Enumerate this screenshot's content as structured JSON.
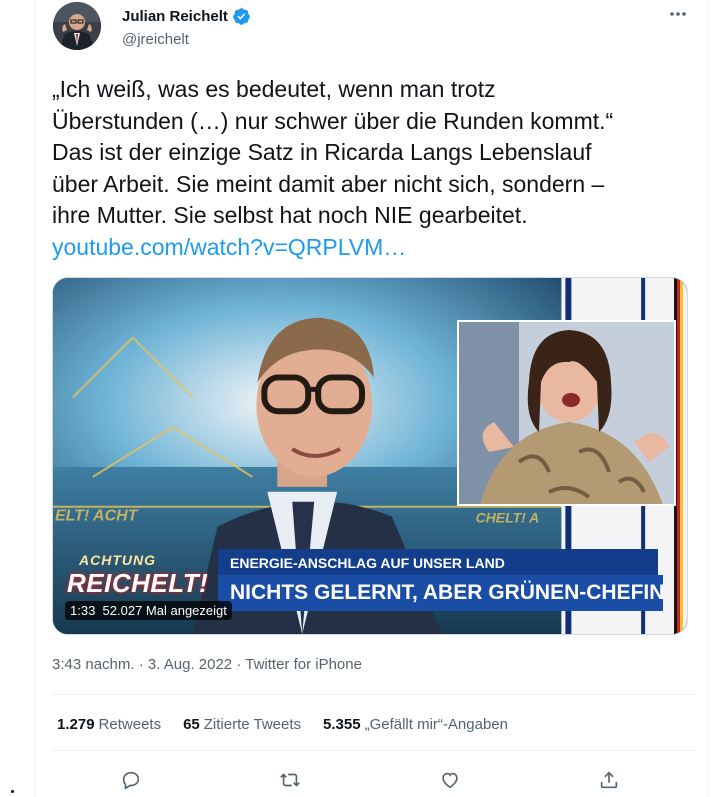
{
  "author": {
    "name": "Julian Reichelt",
    "handle": "@jreichelt"
  },
  "tweet": {
    "lines": [
      "„Ich weiß, was es bedeutet, wenn man trotz",
      "Überstunden (…) nur schwer über die Runden kommt.“",
      "Das ist der einzige Satz in Ricarda Langs Lebenslauf",
      "über Arbeit. Sie meint damit aber nicht sich, sondern –",
      "ihre Mutter. Sie selbst hat noch NIE gearbeitet."
    ],
    "link": "youtube.com/watch?v=QRPLVM…"
  },
  "media": {
    "banner_top": "ENERGIE-ANSCHLAG AUF UNSER LAND",
    "banner_main": "NICHTS GELERNT, ABER GRÜNEN-CHEFIN",
    "logo_top": "ACHTUNG",
    "logo_main": "REICHELT!",
    "duration": "1:33",
    "views": "52.027 Mal angezeigt"
  },
  "meta": {
    "time": "3:43 nachm.",
    "date": "3. Aug. 2022",
    "source": "Twitter for iPhone"
  },
  "stats": {
    "retweets_count": "1.279",
    "retweets_label": "Retweets",
    "quotes_count": "65",
    "quotes_label": "Zitierte Tweets",
    "likes_count": "5.355",
    "likes_label": "„Gefällt mir“-Angaben"
  },
  "icons": {
    "more": "more-icon",
    "verified": "verified-badge-icon",
    "reply": "reply-icon",
    "retweet": "retweet-icon",
    "like": "like-icon",
    "share": "share-icon"
  },
  "colors": {
    "accent": "#1d9bf0",
    "secondary_text": "#536471",
    "banner_dark": "#123e8c",
    "banner_light": "#1a4da6"
  }
}
